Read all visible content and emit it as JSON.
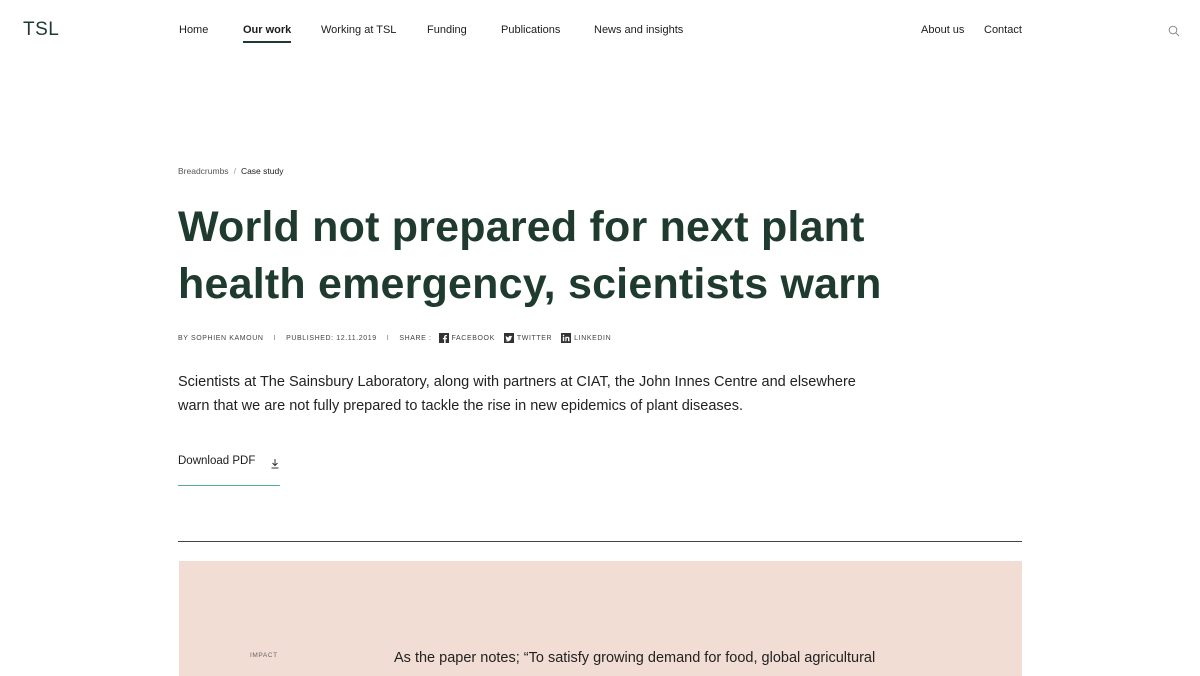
{
  "logo": "TSL",
  "nav": {
    "left": [
      "Home",
      "Our work",
      "Working at TSL",
      "Funding",
      "Publications",
      "News and insights"
    ],
    "right": [
      "About us",
      "Contact"
    ],
    "active": "Our work"
  },
  "icons": {
    "search": "search-icon",
    "facebook": "facebook-icon",
    "twitter": "twitter-icon",
    "linkedin": "linkedin-icon",
    "download": "download-icon"
  },
  "breadcrumb": {
    "parent": "Breadcrumbs",
    "separator": "/",
    "current": "Case study"
  },
  "article": {
    "title": "World not prepared for next plant health emergency, scientists warn",
    "byline": "BY SOPHIEN KAMOUN",
    "published": "PUBLISHED: 12.11.2019",
    "share_label": "SHARE :",
    "share": [
      "FACEBOOK",
      "TWITTER",
      "LINKEDIN"
    ],
    "lede": "Scientists at The Sainsbury Laboratory, along with partners at CIAT, the John Innes Centre and elsewhere warn that we are not fully prepared to tackle the rise in new epidemics of plant diseases.",
    "download_label": "Download PDF"
  },
  "impact": {
    "label": "IMPACT",
    "quote": "As the paper notes; “To satisfy growing demand for food, global agricultural"
  },
  "colors": {
    "brand_green": "#1f3a2e",
    "accent_green": "#5ab08d",
    "impact_bg": "#f1ddd4"
  }
}
